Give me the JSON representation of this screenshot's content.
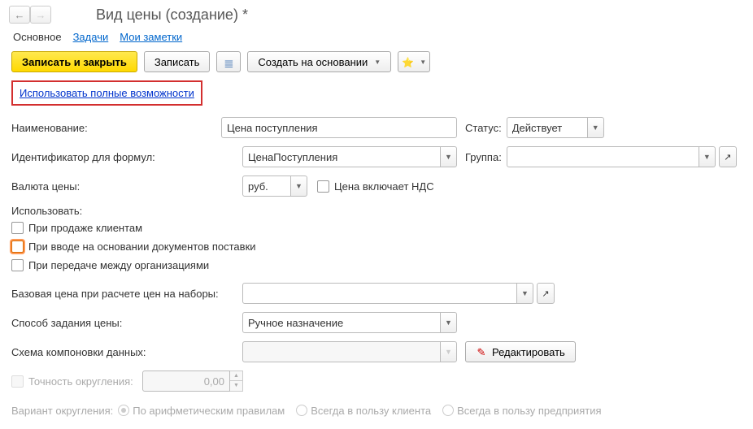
{
  "header": {
    "title": "Вид цены (создание) *"
  },
  "tabs": {
    "main": "Основное",
    "tasks": "Задачи",
    "notes": "Мои заметки"
  },
  "actions": {
    "save_close": "Записать и закрыть",
    "save": "Записать",
    "create_based": "Создать на основании"
  },
  "full_link": "Использовать полные возможности",
  "labels": {
    "name": "Наименование:",
    "formula_id": "Идентификатор для формул:",
    "currency": "Валюта цены:",
    "status": "Статус:",
    "group": "Группа:",
    "vat_incl": "Цена включает НДС",
    "use_section": "Использовать:",
    "use_sale": "При продаже клиентам",
    "use_supply": "При вводе на основании документов поставки",
    "use_transfer": "При передаче между организациями",
    "base_price": "Базовая цена при расчете цен на наборы:",
    "price_method": "Способ задания цены:",
    "data_schema": "Схема компоновки данных:",
    "edit_btn": "Редактировать",
    "precision": "Точность округления:",
    "rounding": "Вариант округления:",
    "round_arith": "По арифметическим правилам",
    "round_client": "Всегда в пользу клиента",
    "round_company": "Всегда в пользу предприятия"
  },
  "values": {
    "name": "Цена поступления",
    "formula_id": "ЦенаПоступления",
    "currency": "руб.",
    "status": "Действует",
    "group": "",
    "base_price": "",
    "price_method": "Ручное назначение",
    "data_schema": "",
    "precision": "0,00"
  }
}
